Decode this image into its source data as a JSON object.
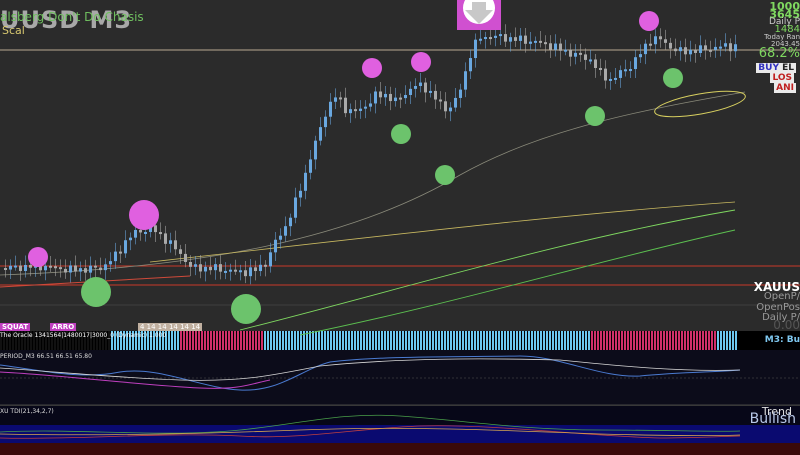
{
  "header": {
    "symbol_title": "UUSD M3",
    "subtitle": "alsberg Don't Do Chasis",
    "mode_label": "Scal"
  },
  "info_panel": {
    "line1": "1000",
    "line2": "3645",
    "line3": "Daily P",
    "line4": "1484",
    "line5": "Today Ran",
    "line6": "2043.45",
    "line7": "68.2%",
    "buy_label": "BUY",
    "buy_value": "EL",
    "loss_label": "LOS",
    "anl_label": "ANI"
  },
  "right_labels": {
    "symbol": "XAUUS",
    "open_pl": "OpenP/",
    "open_pos": "OpenPos",
    "daily_pl": "Daily P/",
    "value": "0.00"
  },
  "bottom_tags": {
    "squat": "SQUAT",
    "arrow": "ARRO",
    "pattern": "4 14 14 14 14 14"
  },
  "strip": {
    "label": "The Oracle  1341564|1480017|3000_0  (Dynamic) 1.000",
    "status": "M3: Bu"
  },
  "oscillator": {
    "label": "PERIOD_M3   66.51 66.51 65.80"
  },
  "trend_pane": {
    "label": "XU TDI(21,34,2,7)",
    "trend_title": "Trend",
    "trend_value": "Bullish"
  },
  "colors": {
    "bull_candle": "#6aa8e0",
    "bear_candle": "#a9a9a9",
    "magenta_dot": "#e060e0",
    "green_dot": "#6cc36c",
    "red_line": "#c83a2a",
    "ma_yellow": "#c8b860",
    "ma_green": "#7fd860"
  },
  "icons": {
    "sell_arrow": "down-arrow-icon"
  }
}
